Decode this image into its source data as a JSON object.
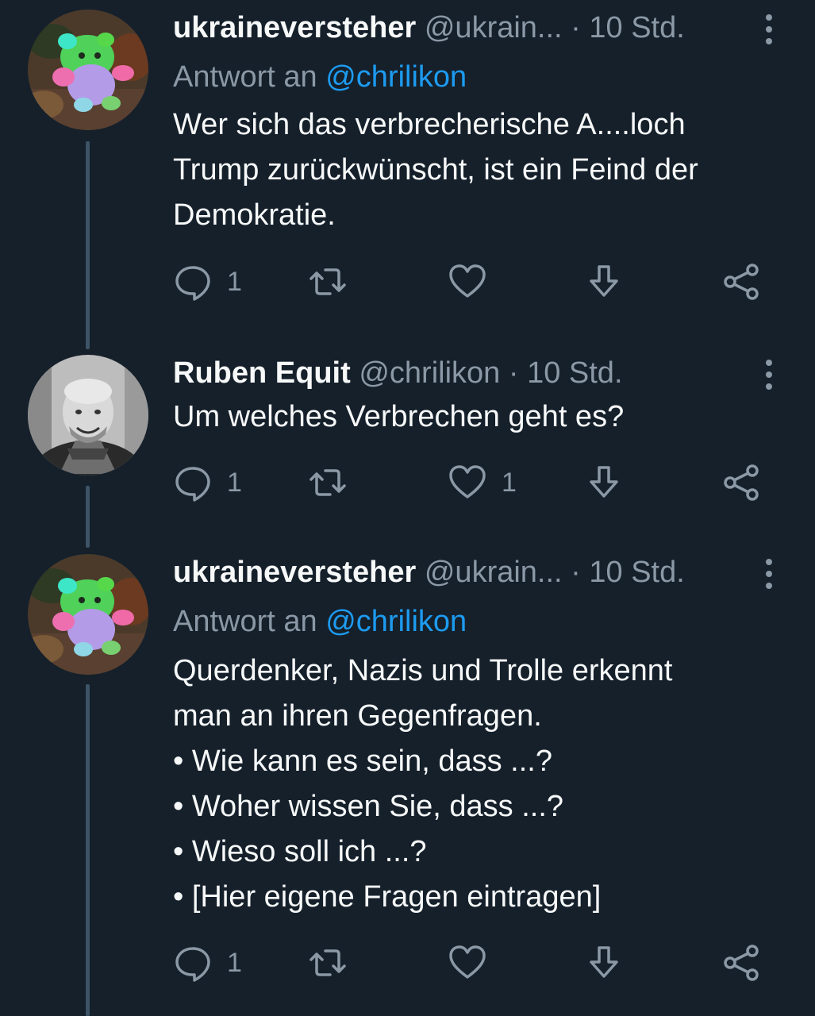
{
  "tweets": [
    {
      "display_name": "ukraineversteher",
      "handle": "@ukrain...",
      "separator": "·",
      "time": "10 Std.",
      "reply_prefix": "Antwort an",
      "reply_handle": "@chrilikon",
      "text_lines": [
        "Wer sich das verbrecherische A....loch",
        "Trump zurückwünscht, ist ein Feind der",
        "Demokratie."
      ],
      "reply_count": "1",
      "retweet_count": "",
      "like_count": ""
    },
    {
      "display_name": "Ruben Equit",
      "handle": "@chrilikon",
      "separator": "·",
      "time": "10 Std.",
      "text_lines": [
        "Um welches Verbrechen geht es?"
      ],
      "reply_count": "1",
      "retweet_count": "",
      "like_count": "1"
    },
    {
      "display_name": "ukraineversteher",
      "handle": "@ukrain...",
      "separator": "·",
      "time": "10 Std.",
      "reply_prefix": "Antwort an",
      "reply_handle": "@chrilikon",
      "text_lines": [
        "Querdenker, Nazis und Trolle erkennt",
        "man an ihren Gegenfragen.",
        "• Wie kann es sein, dass ...?",
        "• Woher wissen Sie, dass ...?",
        "• Wieso soll ich ...?",
        "• [Hier eigene Fragen eintragen]"
      ],
      "reply_count": "1",
      "retweet_count": "",
      "like_count": ""
    }
  ],
  "icons": {
    "reply": "reply-icon",
    "retweet": "retweet-icon",
    "like": "heart-icon",
    "bookmark": "download-arrow-icon",
    "share": "share-icon",
    "more": "more-vertical-icon"
  },
  "colors": {
    "background": "#15202b",
    "text": "#f7f9f9",
    "secondary": "#8b98a5",
    "link": "#1d9bf0",
    "thread_line": "#3d5466"
  }
}
